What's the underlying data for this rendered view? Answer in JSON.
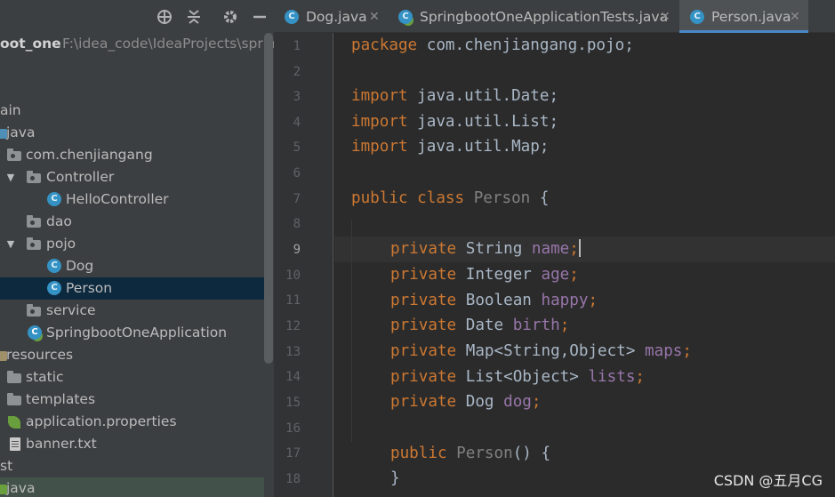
{
  "project_panel": {
    "root_name": "oot_one",
    "root_path": "F:\\idea_code\\IdeaProjects\\spring",
    "header_icons": [
      "crosshair-icon",
      "collapse-icon",
      "gear-icon",
      "minimize-icon"
    ],
    "tree": [
      {
        "label": "ain"
      },
      {
        "label": "java"
      },
      {
        "label": "com.chenjiangang"
      },
      {
        "label": "Controller"
      },
      {
        "label": "HelloController"
      },
      {
        "label": "dao"
      },
      {
        "label": "pojo"
      },
      {
        "label": "Dog"
      },
      {
        "label": "Person"
      },
      {
        "label": "service"
      },
      {
        "label": "SpringbootOneApplication"
      },
      {
        "label": "resources"
      },
      {
        "label": "static"
      },
      {
        "label": "templates"
      },
      {
        "label": "application.properties"
      },
      {
        "label": "banner.txt"
      },
      {
        "label": "st"
      },
      {
        "label": "java"
      }
    ]
  },
  "tabs": [
    {
      "label": "Dog.java",
      "active": false
    },
    {
      "label": "SpringbootOneApplicationTests.java",
      "active": false
    },
    {
      "label": "Person.java",
      "active": true
    }
  ],
  "editor": {
    "line_numbers": [
      "1",
      "2",
      "3",
      "4",
      "5",
      "6",
      "7",
      "8",
      "9",
      "10",
      "11",
      "12",
      "13",
      "14",
      "15",
      "16",
      "17",
      "18"
    ],
    "current_line": "9",
    "code": {
      "package_kw": "package",
      "package_name": " com.chenjiangang.pojo;",
      "import_kw": "import",
      "import_1": " java.util.Date;",
      "import_2": " java.util.List;",
      "import_3": " java.util.Map;",
      "public_kw": "public",
      "class_kw": "class",
      "class_name": "Person",
      "open_brace": " {",
      "private_kw": "private",
      "f1_type": "String ",
      "f1_name": "name",
      "semi": ";",
      "f2_type": "Integer ",
      "f2_name": "age",
      "f3_type": "Boolean ",
      "f3_name": "happy",
      "f4_type": "Date ",
      "f4_name": "birth",
      "f5_type": "Map<String,Object> ",
      "f5_name": "maps",
      "f6_type": "List<Object> ",
      "f6_name": "lists",
      "f7_type": "Dog ",
      "f7_name": "dog",
      "ctor_name": "Person",
      "ctor_rest": "() {",
      "close_brace": "}"
    }
  },
  "watermark": "CSDN @五月CG",
  "colors": {
    "keyword": "#cc7832",
    "field": "#9876aa",
    "text": "#a9b7c6",
    "selection": "#0d293e",
    "tab_underline": "#4a88c7"
  }
}
